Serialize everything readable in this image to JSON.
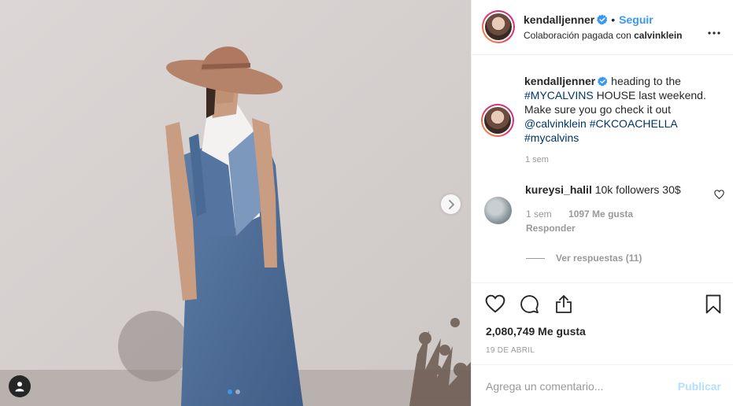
{
  "post": {
    "username": "kendalljenner",
    "follow_label": "Seguir",
    "separator": "•",
    "partnership_prefix": "Colaboración pagada con",
    "partner": "calvinklein",
    "caption_text_1": "heading to the",
    "caption_tag_1": "#MYCALVINS",
    "caption_text_2": "HOUSE last weekend. Make sure you go check it out",
    "caption_tag_2": "@calvinklein",
    "caption_tag_3": "#CKCOACHELLA",
    "caption_tag_4": "#mycalvins",
    "caption_time": "1 sem",
    "likes": "2,080,749 Me gusta",
    "date": "19 DE ABRIL"
  },
  "comment": {
    "username": "kureysi_halil",
    "text": "10k followers 30$",
    "time": "1 sem",
    "likes": "1097 Me gusta",
    "reply_label": "Responder",
    "view_replies": "Ver respuestas (11)"
  },
  "add_comment": {
    "placeholder": "Agrega un comentario...",
    "publish_label": "Publicar"
  },
  "carousel": {
    "total": 2,
    "active": 1
  },
  "icons": [
    "verified-icon",
    "more-icon",
    "heart-icon",
    "comment-icon",
    "share-icon",
    "bookmark-icon",
    "chevron-right-icon",
    "user-tag-icon"
  ],
  "colors": {
    "link": "#3897f0",
    "hashtag": "#003569",
    "muted": "#999999",
    "publish_disabled": "#b2dffc"
  }
}
